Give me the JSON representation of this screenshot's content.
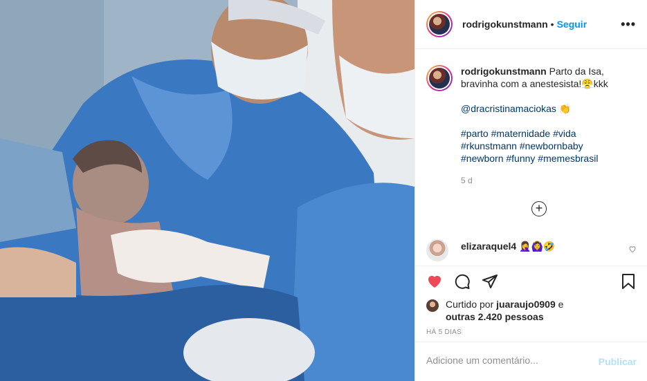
{
  "post": {
    "username": "rodrigokunstmann",
    "follow_label": "Seguir",
    "separator": "•",
    "more_label": "•••",
    "photo_alt": "newborn-baby-photo"
  },
  "caption": {
    "username": "rodrigokunstmann",
    "text": "Parto da Isa, bravinha com a anestesista!😤kkk",
    "mention": "@dracristinamaciokas",
    "mention_emoji": "👏",
    "hashtags_line1": "#parto #maternidade #vida",
    "hashtags_line2": "#rkunstmann #newbornbaby",
    "hashtags_line3": "#newborn #funny #memesbrasil",
    "age": "5 d",
    "load_more": "+"
  },
  "comment": {
    "username": "elizaraquel4",
    "text": "🤦‍♀️🙆‍♀️🤣",
    "like_icon": "heart-outline-icon"
  },
  "actions": {
    "like_icon": "heart-filled-icon",
    "comment_icon": "comment-icon",
    "share_icon": "share-icon",
    "save_icon": "bookmark-icon",
    "like_color": "#ed4956"
  },
  "likes": {
    "prefix": "Curtido por ",
    "liker": "juaraujo0909",
    "middle": " e",
    "others": "outras 2.420 pessoas"
  },
  "timestamp": "HÁ 5 DIAS",
  "add_comment": {
    "placeholder": "Adicione um comentário...",
    "publish_label": "Publicar"
  }
}
